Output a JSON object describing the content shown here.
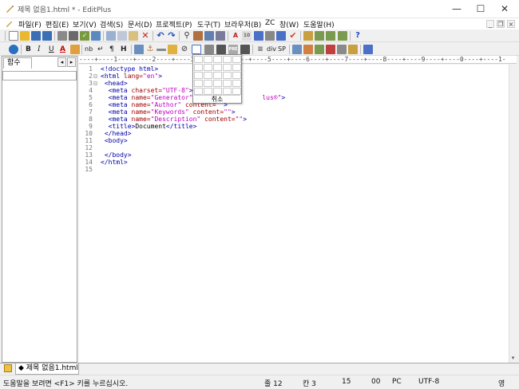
{
  "window": {
    "title": "제목 없음1.html * - EditPlus"
  },
  "menu": {
    "items": [
      "파일(F)",
      "편집(E)",
      "보기(V)",
      "검색(S)",
      "문서(D)",
      "프로젝트(P)",
      "도구(T)",
      "브라우저(B)",
      "ZC",
      "창(W)",
      "도움말(H)"
    ]
  },
  "toolbar2": {
    "bold": "B",
    "italic": "I",
    "underline": "U",
    "font_color": "A",
    "nbsp": "nb",
    "br": "↵",
    "para": "¶",
    "heading": "H",
    "div": "div",
    "span": "SP"
  },
  "left_pane": {
    "tab_label": "함수",
    "prev": "◂",
    "next": "▸"
  },
  "ruler": {
    "text": "----+----1----+----2----+----3----+----4----+----5----+----6----+----7----+----8----+----9----+----0----+----1-"
  },
  "editor": {
    "line_numbers": [
      "1",
      "2",
      "3",
      "4",
      "5",
      "6",
      "7",
      "8",
      "9",
      "10",
      "11",
      "12",
      "13",
      "14",
      "15"
    ]
  },
  "table_popup": {
    "cancel_label": "취소"
  },
  "doc_tabs": [
    {
      "label": "◆ 제목 없음1.html"
    }
  ],
  "status": {
    "help_text": "도움말을 보려면 <F1> 키를 누르십시오.",
    "line": "줄 12",
    "col": "칸 3",
    "num1": "15",
    "num2": "00",
    "mode": "PC",
    "encoding": "UTF-8",
    "ime": "영"
  }
}
